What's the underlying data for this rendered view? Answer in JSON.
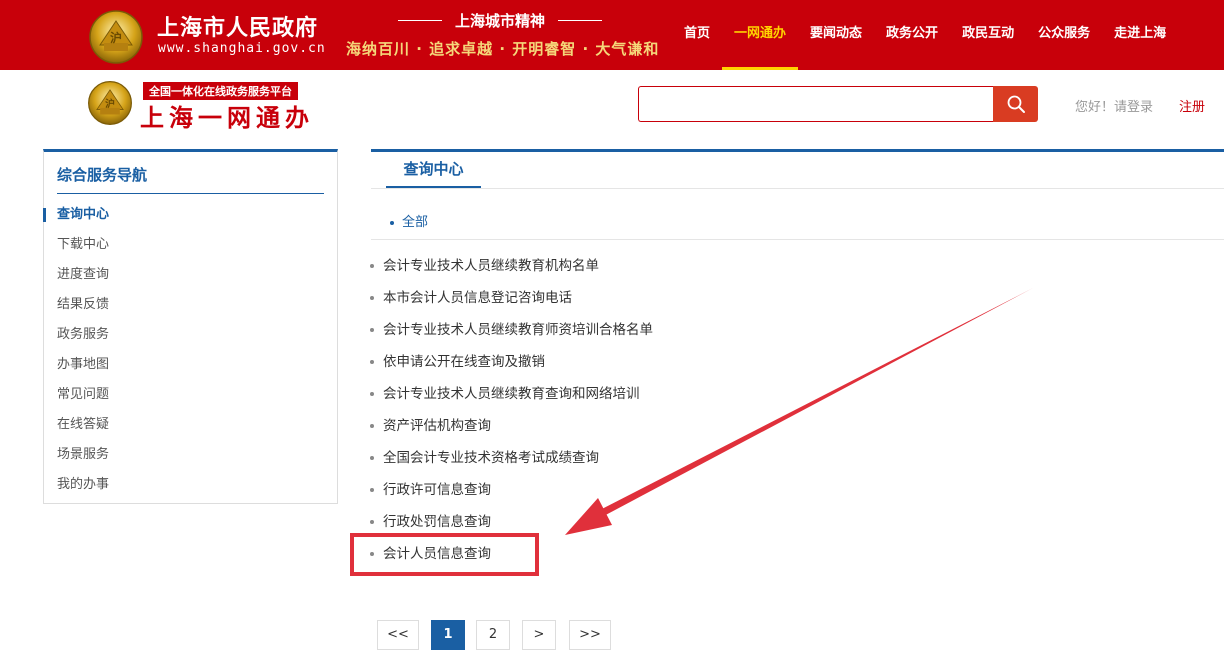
{
  "header": {
    "gov_title": "上海市人民政府",
    "gov_url": "www.shanghai.gov.cn",
    "city_spirit_title": "上海城市精神",
    "city_spirit_motto": "海纳百川 · 追求卓越 · 开明睿智 · 大气谦和",
    "nav": [
      {
        "label": "首页",
        "active": false
      },
      {
        "label": "一网通办",
        "active": true
      },
      {
        "label": "要闻动态",
        "active": false
      },
      {
        "label": "政务公开",
        "active": false
      },
      {
        "label": "政民互动",
        "active": false
      },
      {
        "label": "公众服务",
        "active": false
      },
      {
        "label": "走进上海",
        "active": false
      }
    ]
  },
  "subheader": {
    "emblem_text": "沪",
    "platform_badge": "全国一体化在线政务服务平台",
    "title": "上海一网通办",
    "search_value": "",
    "search_placeholder": "",
    "greeting": "您好！请登录",
    "register": "注册"
  },
  "sidebar": {
    "title": "综合服务导航",
    "items": [
      {
        "label": "查询中心",
        "active": true
      },
      {
        "label": "下载中心",
        "active": false
      },
      {
        "label": "进度查询",
        "active": false
      },
      {
        "label": "结果反馈",
        "active": false
      },
      {
        "label": "政务服务",
        "active": false
      },
      {
        "label": "办事地图",
        "active": false
      },
      {
        "label": "常见问题",
        "active": false
      },
      {
        "label": "在线答疑",
        "active": false
      },
      {
        "label": "场景服务",
        "active": false
      },
      {
        "label": "我的办事",
        "active": false
      }
    ]
  },
  "main": {
    "tab_label": "查询中心",
    "filter_all": "全部",
    "results": [
      "会计专业技术人员继续教育机构名单",
      "本市会计人员信息登记咨询电话",
      "会计专业技术人员继续教育师资培训合格名单",
      "依申请公开在线查询及撤销",
      "会计专业技术人员继续教育查询和网络培训",
      "资产评估机构查询",
      "全国会计专业技术资格考试成绩查询",
      "行政许可信息查询",
      "行政处罚信息查询",
      "会计人员信息查询"
    ],
    "highlighted_index": 9
  },
  "pagination": {
    "first": "<<",
    "pages": [
      "1",
      "2"
    ],
    "current": "1",
    "next": ">",
    "last": ">>"
  },
  "colors": {
    "header_red": "#c8000a",
    "nav_active": "#ffd400",
    "accent_blue": "#1a5fa3",
    "search_button": "#d93c22",
    "annotation_red": "#e0303b",
    "emblem_gold": "#d6a419"
  },
  "icons": {
    "emblem": "shanghai-emblem-icon",
    "search": "search-icon",
    "arrow": "annotation-arrow-icon"
  }
}
